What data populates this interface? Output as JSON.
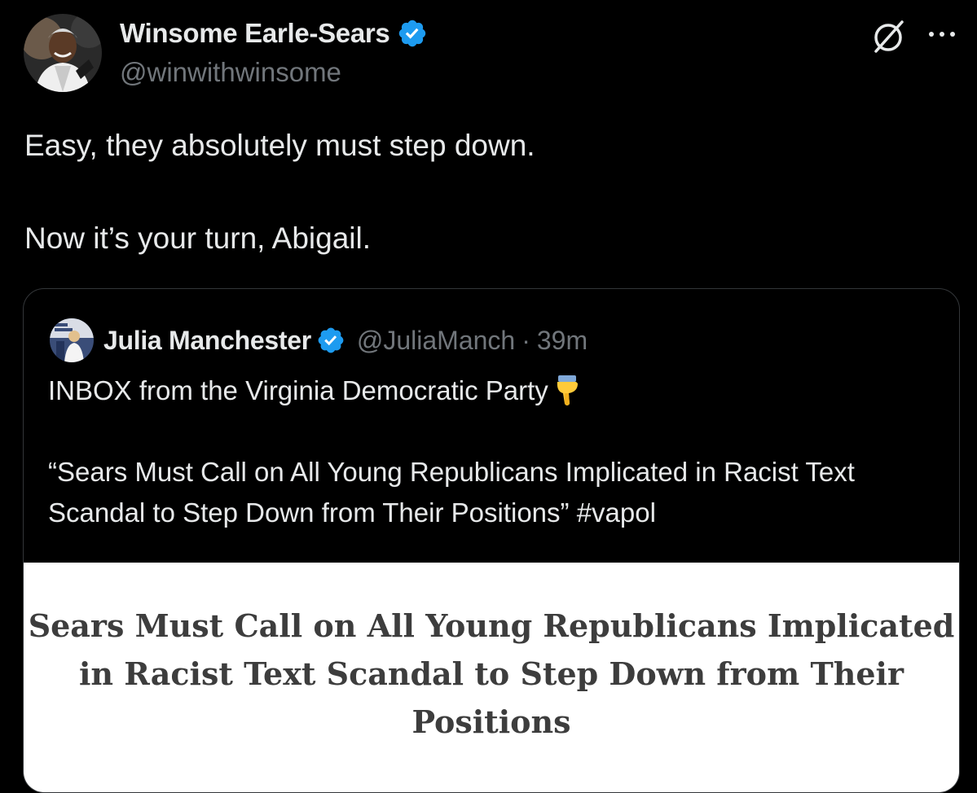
{
  "author": {
    "display_name": "Winsome Earle-Sears",
    "handle": "@winwithwinsome",
    "verified_badge_icon": "verified-badge-icon",
    "avatar_icon": "profile-photo"
  },
  "header_actions": {
    "grok_icon": "grok-icon",
    "more_icon": "more-dots-icon"
  },
  "tweet": {
    "line1": "Easy, they absolutely must step down.",
    "line2": "Now it’s your turn, Abigail."
  },
  "quote": {
    "display_name": "Julia Manchester",
    "handle": "@JuliaManch",
    "separator": "·",
    "time": "39m",
    "line1": "INBOX from the Virginia Democratic Party",
    "emoji_icon": "pointing-down-emoji",
    "line2": "“Sears Must Call on All Young Republicans Implicated in Racist Text Scandal to Step Down from Their Positions”",
    "hashtag": "#vapol",
    "image_title": "Sears Must Call on All Young Republicans Implicated in Racist Text Scandal to Step Down from Their Positions"
  },
  "colors": {
    "background": "#000000",
    "text_primary": "#e7e9ea",
    "text_secondary": "#71767b",
    "verified_blue": "#1d9bf0",
    "card_border": "#333639"
  }
}
